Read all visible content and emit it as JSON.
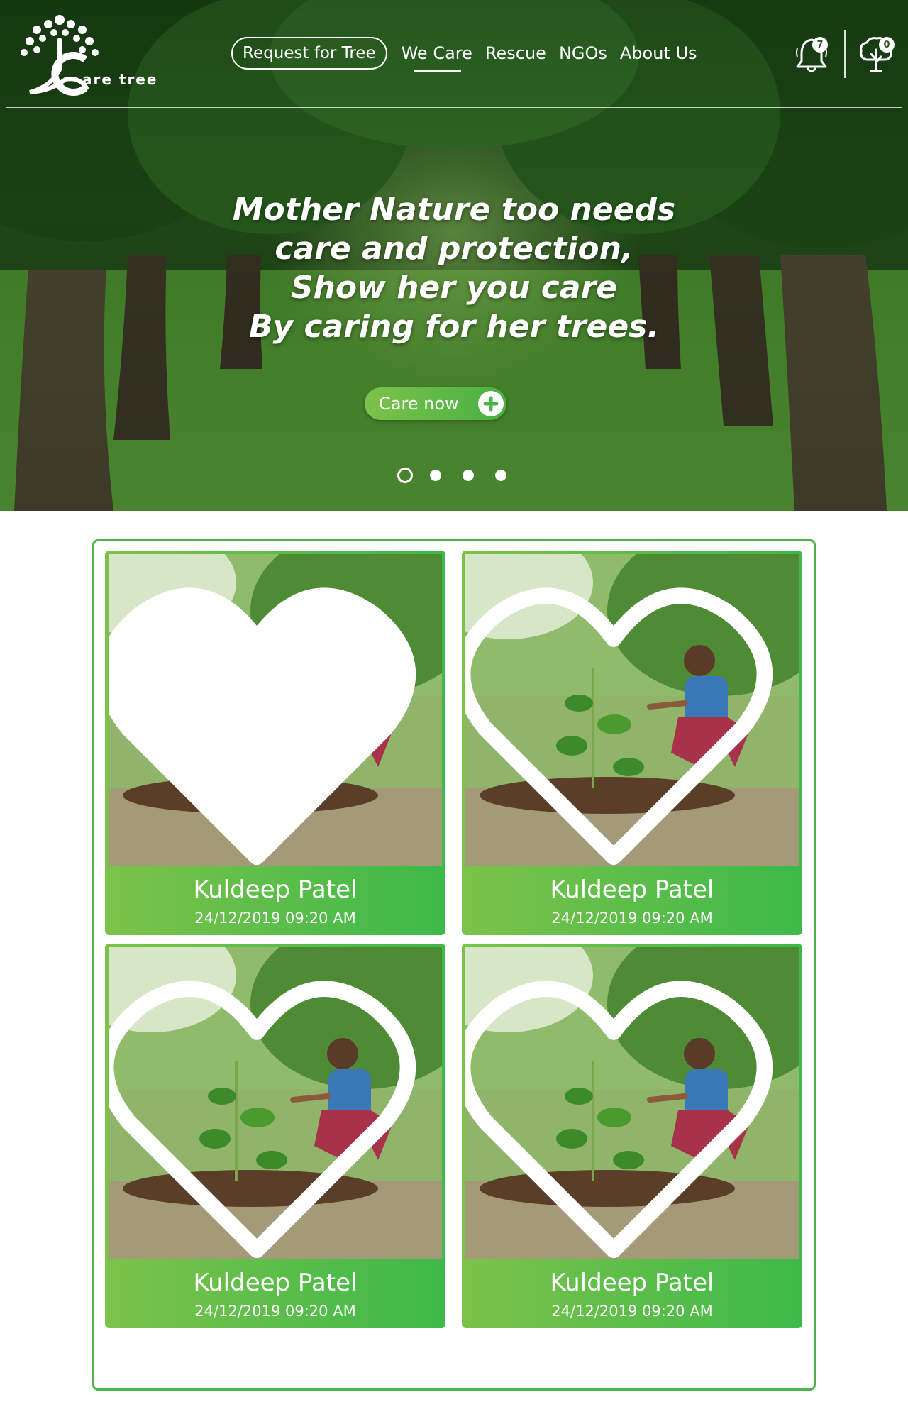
{
  "brand": {
    "logo_text": "are tree"
  },
  "nav": {
    "request_label": "Request for Tree",
    "links": [
      "We Care",
      "Rescue",
      "NGOs",
      "About Us"
    ],
    "active": "We Care"
  },
  "header_icons": {
    "bell_icon": "bell-icon",
    "notification_count": "7",
    "tree_icon": "tree-icon",
    "tree_count": "0"
  },
  "hero": {
    "lines": [
      "Mother Nature too needs",
      "care and protection,",
      "Show her you care",
      "By caring for her trees."
    ],
    "cta_label": "Care now",
    "slides_total": 4,
    "slide_active": 1
  },
  "cards": [
    {
      "name": "Kuldeep Patel",
      "date": "24/12/2019  09:20 AM",
      "liked": true
    },
    {
      "name": "Kuldeep Patel",
      "date": "24/12/2019  09:20 AM",
      "liked": false
    },
    {
      "name": "Kuldeep Patel",
      "date": "24/12/2019  09:20 AM",
      "liked": false
    },
    {
      "name": "Kuldeep Patel",
      "date": "24/12/2019  09:20 AM",
      "liked": false
    }
  ],
  "colors": {
    "accent_green": "#4db34a",
    "card_gradient_start": "#7cc24a",
    "card_gradient_end": "#3db94a"
  }
}
